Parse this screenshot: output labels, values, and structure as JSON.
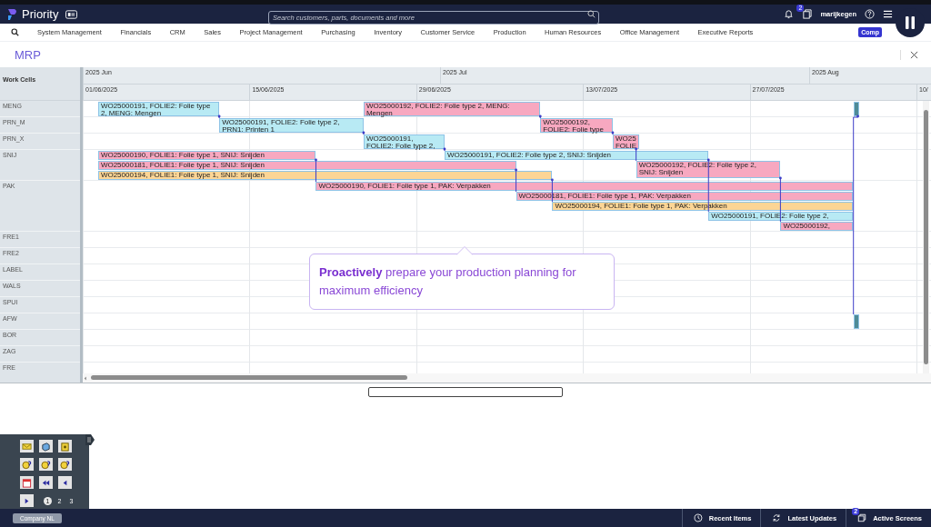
{
  "top_bar": {
    "app_name": "Priority",
    "search": {
      "placeholder": "Search customers, parts, documents and more"
    },
    "screens_badge": "2",
    "user": "marijkegen"
  },
  "nav": {
    "items": [
      "System Management",
      "Financials",
      "CRM",
      "Sales",
      "Project Management",
      "Purchasing",
      "Inventory",
      "Customer Service",
      "Production",
      "Human Resources",
      "Office Management",
      "Executive Reports"
    ],
    "company_button": "Comp"
  },
  "page_title": "MRP",
  "gantt": {
    "cells_heading": "Work Cells",
    "months": [
      "2025 Jun",
      "2025 Jul",
      "2025 Aug"
    ],
    "dates": [
      "01/06/2025",
      "15/06/2025",
      "29/06/2025",
      "13/07/2025",
      "27/07/2025",
      "10/"
    ],
    "work_cells": [
      {
        "name": "MENG",
        "bars": [
          {
            "color": "#b8eaf4",
            "lines": [
              "WO25000191, FOLIE2: Folie type",
              "2, MENG: Mengen"
            ]
          },
          {
            "color": "#f7a8c0",
            "lines": [
              "WO25000192, FOLIE2: Folie type 2, MENG:",
              "Mengen"
            ]
          },
          {
            "color": "#4f8b96"
          }
        ]
      },
      {
        "name": "PRN_M",
        "bars": [
          {
            "color": "#b8eaf4",
            "lines": [
              "WO25000191, FOLIE2: Folie type 2,",
              "PRN1: Printen 1"
            ]
          },
          {
            "color": "#f7a8c0",
            "lines": [
              "WO25000192,",
              "FOLIE2: Folie type"
            ]
          }
        ]
      },
      {
        "name": "PRN_X",
        "bars": [
          {
            "color": "#b8eaf4",
            "lines": [
              "WO25000191,",
              "FOLIE2: Folie type 2,"
            ]
          },
          {
            "color": "#f7a8c0",
            "lines": [
              "WO25",
              "FOLIE"
            ]
          }
        ]
      },
      {
        "name": "SNIJ",
        "bars": [
          {
            "color": "#f7a8c0",
            "lines": [
              "WO25000190, FOLIE1: Folie type 1, SNIJ: Snijden"
            ]
          },
          {
            "color": "#f7a8c0",
            "lines": [
              "WO25000181, FOLIE1: Folie type 1, SNIJ: Snijden"
            ]
          },
          {
            "color": "#fcd595",
            "lines": [
              "WO25000194, FOLIE1: Folie type 1, SNIJ: Snijden"
            ]
          },
          {
            "color": "#b8eaf4",
            "lines": [
              "WO25000191, FOLIE2: Folie type 2, SNIJ: Snijden"
            ]
          },
          {
            "color": "#f7a8c0",
            "lines": [
              "WO25000192, FOLIE2: Folie type 2,",
              "SNIJ: Snijden"
            ]
          }
        ]
      },
      {
        "name": "PAK",
        "bars": [
          {
            "color": "#f7a8c0",
            "lines": [
              "WO25000190, FOLIE1: Folie type 1, PAK: Verpakken"
            ]
          },
          {
            "color": "#f7a8c0",
            "lines": [
              "WO25000181, FOLIE1: Folie type 1, PAK: Verpakken"
            ]
          },
          {
            "color": "#fcd595",
            "lines": [
              "WO25000194, FOLIE1: Folie type 1, PAK: Verpakken"
            ]
          },
          {
            "color": "#b8eaf4",
            "lines": [
              "WO25000191, FOLIE2: Folie type 2,"
            ]
          },
          {
            "color": "#f7a8c0",
            "lines": [
              "WO25000192,"
            ]
          }
        ]
      },
      {
        "name": "FRE1"
      },
      {
        "name": "FRE2"
      },
      {
        "name": "LABEL"
      },
      {
        "name": "WALS"
      },
      {
        "name": "SPUI"
      },
      {
        "name": "AFW",
        "bars": [
          {
            "color": "#4f8b96"
          }
        ]
      },
      {
        "name": "BOR"
      },
      {
        "name": "ZAG"
      },
      {
        "name": "FRE"
      }
    ]
  },
  "tooltip": "**Proactively** prepare your production planning for maximum efficiency",
  "palette": {
    "pages": [
      {
        "label": "1",
        "selected": true
      },
      {
        "label": "2",
        "selected": false
      },
      {
        "label": "3",
        "selected": false
      }
    ]
  },
  "bottom_bar": {
    "company": "Company NL",
    "recent": "Recent Items",
    "updates": "Latest Updates",
    "active": "Active Screens",
    "active_badge": "2"
  }
}
